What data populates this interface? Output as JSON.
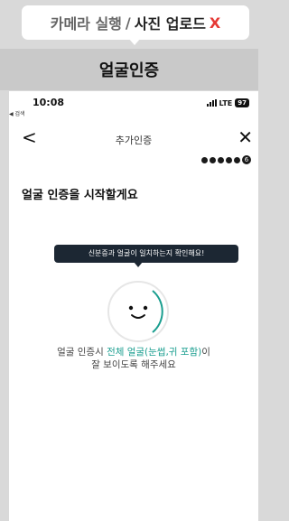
{
  "caption": {
    "part1": "카메라 실행",
    "separator": "/",
    "part2": "사진 업로드",
    "close_mark": "X"
  },
  "banner": {
    "title": "얼굴인증"
  },
  "status_bar": {
    "time": "10:08",
    "back_app": "◀ 검색",
    "network": "LTE",
    "battery": "97"
  },
  "nav": {
    "back_glyph": "<",
    "title": "추가인증",
    "close_glyph": "✕"
  },
  "progress": {
    "current_step": "6",
    "total_steps": 6
  },
  "main": {
    "headline": "얼굴 인증을 시작할게요",
    "tooltip": "신분증과 얼굴이 일치하는지 확인해요!",
    "instruction_line1_pre": "얼굴 인증시 ",
    "instruction_line1_hl": "전체 얼굴(눈썹,귀 포함)",
    "instruction_line1_post": "이",
    "instruction_line2": "잘 보이도록 해주세요"
  },
  "colors": {
    "accent_teal": "#1a9e8f",
    "close_red": "#e53935",
    "tooltip_bg": "#1c2733"
  }
}
